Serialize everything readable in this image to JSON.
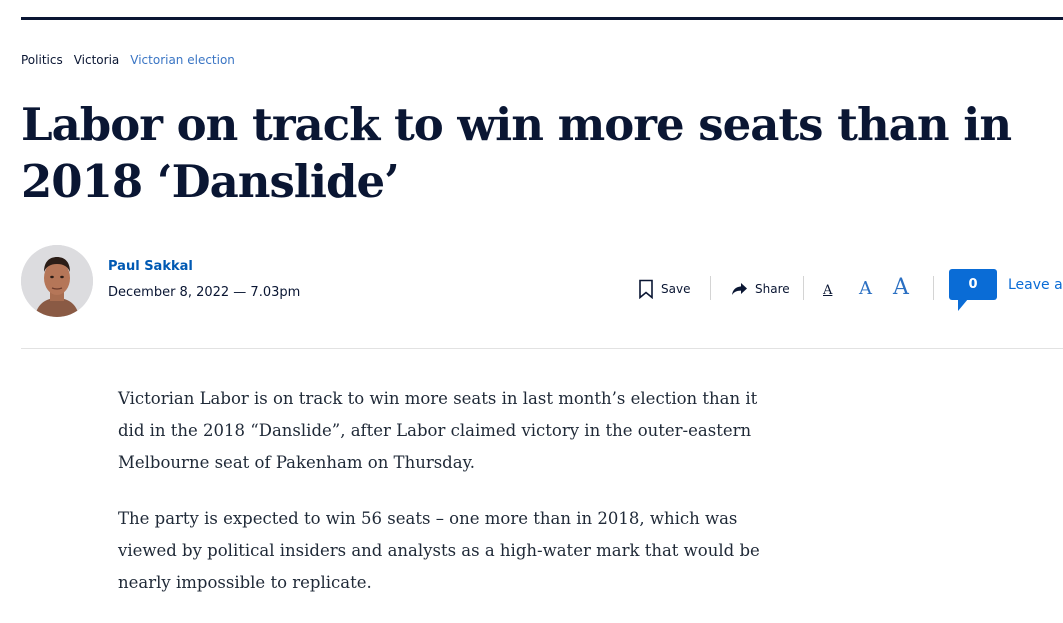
{
  "breadcrumb": [
    {
      "label": "Politics",
      "active": false
    },
    {
      "label": "Victoria",
      "active": false
    },
    {
      "label": "Victorian election",
      "active": true
    }
  ],
  "article": {
    "headline": "Labor on track to win more seats than in 2018 ‘Danslide’",
    "author": "Paul Sakkal",
    "dateline": "December 8, 2022 — 7.03pm",
    "paragraphs": [
      "Victorian Labor is on track to win more seats in last month’s election than it did in the 2018 “Danslide”, after Labor claimed victory in the outer-eastern Melbourne seat of Pakenham on Thursday.",
      "The party is expected to win 56 seats – one more than in 2018, which was viewed by political insiders and analysts as a high-water mark that would be nearly impossible to replicate."
    ]
  },
  "toolbar": {
    "save_label": "Save",
    "share_label": "Share",
    "font_sizes": [
      "A",
      "A",
      "A"
    ],
    "comment_count": "0",
    "comment_label": "Leave a"
  },
  "colors": {
    "brand": "#0a1633",
    "link": "#0059b3",
    "accent": "#0a6cd6"
  }
}
